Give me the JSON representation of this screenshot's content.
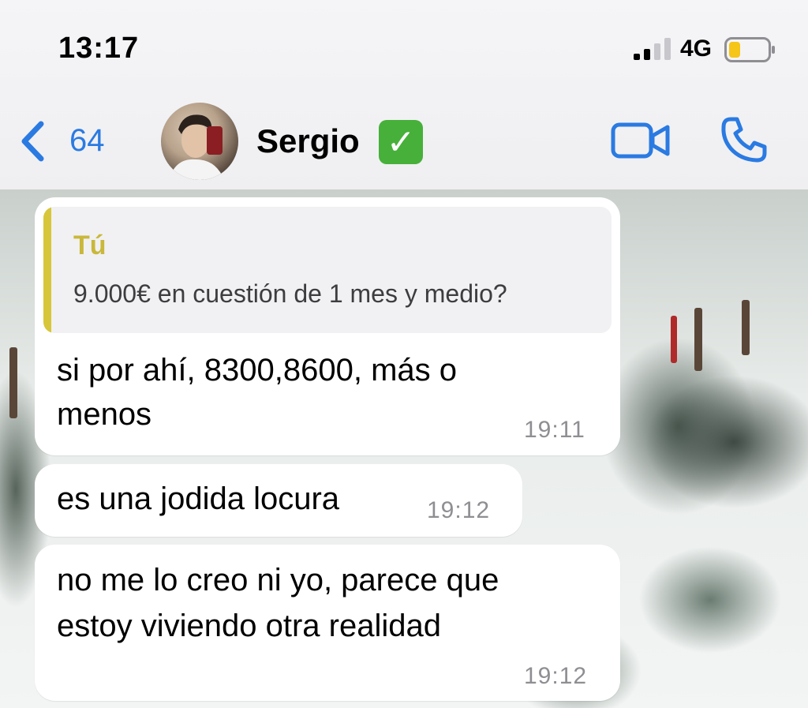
{
  "status_bar": {
    "time": "13:17",
    "network": "4G",
    "battery_color": "#f5c518"
  },
  "header": {
    "back_count": "64",
    "contact_name": "Sergio",
    "verified_glyph": "✓",
    "accent_color": "#2a7ae2",
    "icons": [
      "chevron-left-icon",
      "video-camera-icon",
      "phone-icon"
    ]
  },
  "messages": [
    {
      "quote": {
        "author": "Tú",
        "text": "9.000€ en cuestión de 1 mes y medio?"
      },
      "lines": [
        "si por ahí, 8300,8600, más o",
        "menos"
      ],
      "time": "19:11"
    },
    {
      "lines": [
        "es una jodida locura"
      ],
      "time": "19:12"
    },
    {
      "lines": [
        "no me lo creo ni yo, parece que",
        "estoy viviendo otra realidad"
      ],
      "time": "19:12"
    }
  ]
}
